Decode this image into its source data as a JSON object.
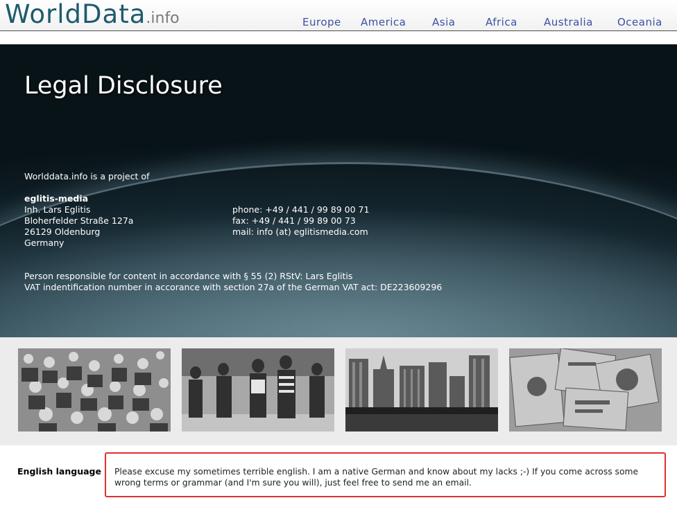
{
  "header": {
    "logo_main": "WorldData",
    "logo_suffix": ".info",
    "nav": [
      {
        "label": "Europe"
      },
      {
        "label": "America"
      },
      {
        "label": "Asia"
      },
      {
        "label": "Africa"
      },
      {
        "label": "Australia"
      },
      {
        "label": "Oceania"
      }
    ]
  },
  "hero": {
    "title": "Legal Disclosure",
    "intro": "Worlddata.info is a project of",
    "company": "eglitis-media",
    "owner": "Inh. Lars Eglitis",
    "street": "Bloherfelder Straße 127a",
    "city": "26129 Oldenburg",
    "country": "Germany",
    "phone": "phone:  +49 / 441 / 99 89 00 71",
    "fax": "fax: +49 / 441 / 99 89 00 73",
    "mail": "mail: info (at) eglitismedia.com",
    "responsible": "Person responsible for content in accordance with § 55 (2) RStV: Lars Eglitis",
    "vat": "VAT indentification number in accorance with section 27a of the German VAT act: DE223609296"
  },
  "gallery": [
    {
      "icon": "crowd-photo"
    },
    {
      "icon": "street-people-photo"
    },
    {
      "icon": "city-skyline-photo"
    },
    {
      "icon": "banknotes-photo"
    }
  ],
  "footer": {
    "label": "English language",
    "notice": "Please excuse my sometimes terrible english. I am a native German and know about my lacks ;-) If you come across some wrong terms or grammar (and I'm sure you will), just feel free to send me an email.",
    "highlight_color": "#e03030"
  },
  "colors": {
    "logo": "#1e5a6e",
    "nav": "#3b4fa3"
  }
}
